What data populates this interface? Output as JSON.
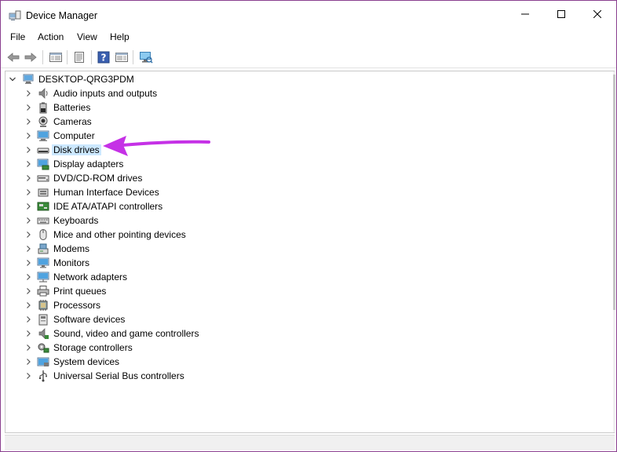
{
  "window": {
    "title": "Device Manager"
  },
  "menu": {
    "items": [
      "File",
      "Action",
      "View",
      "Help"
    ]
  },
  "toolbar": {
    "buttons": [
      "back-icon",
      "forward-icon",
      "show-hide-console-tree-icon",
      "properties-icon",
      "help-icon",
      "action-pane-icon",
      "scan-hardware-icon"
    ]
  },
  "tree": {
    "root": "DESKTOP-QRG3PDM",
    "items": [
      {
        "label": "Audio inputs and outputs",
        "icon": "speaker-icon"
      },
      {
        "label": "Batteries",
        "icon": "battery-icon"
      },
      {
        "label": "Cameras",
        "icon": "camera-icon"
      },
      {
        "label": "Computer",
        "icon": "computer-icon"
      },
      {
        "label": "Disk drives",
        "icon": "disk-drive-icon"
      },
      {
        "label": "Display adapters",
        "icon": "display-adapter-icon"
      },
      {
        "label": "DVD/CD-ROM drives",
        "icon": "dvd-drive-icon"
      },
      {
        "label": "Human Interface Devices",
        "icon": "hid-icon"
      },
      {
        "label": "IDE ATA/ATAPI controllers",
        "icon": "ide-controller-icon"
      },
      {
        "label": "Keyboards",
        "icon": "keyboard-icon"
      },
      {
        "label": "Mice and other pointing devices",
        "icon": "mouse-icon"
      },
      {
        "label": "Modems",
        "icon": "modem-icon"
      },
      {
        "label": "Monitors",
        "icon": "monitor-icon"
      },
      {
        "label": "Network adapters",
        "icon": "network-adapter-icon"
      },
      {
        "label": "Print queues",
        "icon": "printer-icon"
      },
      {
        "label": "Processors",
        "icon": "processor-icon"
      },
      {
        "label": "Software devices",
        "icon": "software-device-icon"
      },
      {
        "label": "Sound, video and game controllers",
        "icon": "sound-controller-icon"
      },
      {
        "label": "Storage controllers",
        "icon": "storage-controller-icon"
      },
      {
        "label": "System devices",
        "icon": "system-device-icon"
      },
      {
        "label": "Universal Serial Bus controllers",
        "icon": "usb-icon"
      }
    ]
  },
  "colors": {
    "border": "#8a3f8f",
    "highlight_arrow": "#c531e6",
    "selection": "#cce8ff"
  }
}
